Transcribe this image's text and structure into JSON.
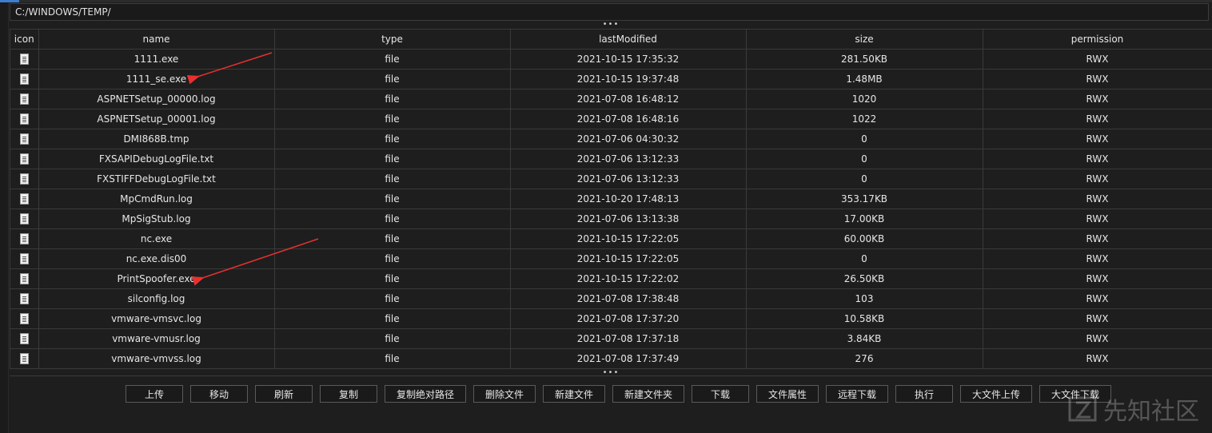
{
  "path": "C:/WINDOWS/TEMP/",
  "splitter_glyph": "•••",
  "columns": [
    "icon",
    "name",
    "type",
    "lastModified",
    "size",
    "permission"
  ],
  "rows": [
    {
      "icon": "file-icon",
      "name": "1111.exe",
      "type": "file",
      "lastModified": "2021-10-15 17:35:32",
      "size": "281.50KB",
      "permission": "RWX"
    },
    {
      "icon": "file-icon",
      "name": "1111_se.exe",
      "type": "file",
      "lastModified": "2021-10-15 19:37:48",
      "size": "1.48MB",
      "permission": "RWX"
    },
    {
      "icon": "file-icon",
      "name": "ASPNETSetup_00000.log",
      "type": "file",
      "lastModified": "2021-07-08 16:48:12",
      "size": "1020",
      "permission": "RWX"
    },
    {
      "icon": "file-icon",
      "name": "ASPNETSetup_00001.log",
      "type": "file",
      "lastModified": "2021-07-08 16:48:16",
      "size": "1022",
      "permission": "RWX"
    },
    {
      "icon": "file-icon",
      "name": "DMI868B.tmp",
      "type": "file",
      "lastModified": "2021-07-06 04:30:32",
      "size": "0",
      "permission": "RWX"
    },
    {
      "icon": "file-icon",
      "name": "FXSAPIDebugLogFile.txt",
      "type": "file",
      "lastModified": "2021-07-06 13:12:33",
      "size": "0",
      "permission": "RWX"
    },
    {
      "icon": "file-icon",
      "name": "FXSTIFFDebugLogFile.txt",
      "type": "file",
      "lastModified": "2021-07-06 13:12:33",
      "size": "0",
      "permission": "RWX"
    },
    {
      "icon": "file-icon",
      "name": "MpCmdRun.log",
      "type": "file",
      "lastModified": "2021-10-20 17:48:13",
      "size": "353.17KB",
      "permission": "RWX"
    },
    {
      "icon": "file-icon",
      "name": "MpSigStub.log",
      "type": "file",
      "lastModified": "2021-07-06 13:13:38",
      "size": "17.00KB",
      "permission": "RWX"
    },
    {
      "icon": "file-icon",
      "name": "nc.exe",
      "type": "file",
      "lastModified": "2021-10-15 17:22:05",
      "size": "60.00KB",
      "permission": "RWX"
    },
    {
      "icon": "file-icon",
      "name": "nc.exe.dis00",
      "type": "file",
      "lastModified": "2021-10-15 17:22:05",
      "size": "0",
      "permission": "RWX"
    },
    {
      "icon": "file-icon",
      "name": "PrintSpoofer.exe",
      "type": "file",
      "lastModified": "2021-10-15 17:22:02",
      "size": "26.50KB",
      "permission": "RWX"
    },
    {
      "icon": "file-icon",
      "name": "silconfig.log",
      "type": "file",
      "lastModified": "2021-07-08 17:38:48",
      "size": "103",
      "permission": "RWX"
    },
    {
      "icon": "file-icon",
      "name": "vmware-vmsvc.log",
      "type": "file",
      "lastModified": "2021-07-08 17:37:20",
      "size": "10.58KB",
      "permission": "RWX"
    },
    {
      "icon": "file-icon",
      "name": "vmware-vmusr.log",
      "type": "file",
      "lastModified": "2021-07-08 17:37:18",
      "size": "3.84KB",
      "permission": "RWX"
    },
    {
      "icon": "file-icon",
      "name": "vmware-vmvss.log",
      "type": "file",
      "lastModified": "2021-07-08 17:37:49",
      "size": "276",
      "permission": "RWX"
    }
  ],
  "buttons": [
    {
      "id": "upload-button",
      "label": "上传"
    },
    {
      "id": "move-button",
      "label": "移动"
    },
    {
      "id": "refresh-button",
      "label": "刷新"
    },
    {
      "id": "copy-button",
      "label": "复制"
    },
    {
      "id": "copy-absolute-path-button",
      "label": "复制绝对路径"
    },
    {
      "id": "delete-file-button",
      "label": "删除文件"
    },
    {
      "id": "new-file-button",
      "label": "新建文件"
    },
    {
      "id": "new-folder-button",
      "label": "新建文件夹"
    },
    {
      "id": "download-button",
      "label": "下载"
    },
    {
      "id": "file-properties-button",
      "label": "文件属性"
    },
    {
      "id": "remote-download-button",
      "label": "远程下载"
    },
    {
      "id": "execute-button",
      "label": "执行"
    },
    {
      "id": "big-file-upload-button",
      "label": "大文件上传"
    },
    {
      "id": "big-file-download-button",
      "label": "大文件下载"
    }
  ],
  "watermark": {
    "text": "先知社区"
  },
  "annotation_color": "#e8312f",
  "colors": {
    "background": "#1e1e1e",
    "grid": "#3a3a3a",
    "text": "#e6e6e6",
    "accent": "#3c7fd1"
  }
}
